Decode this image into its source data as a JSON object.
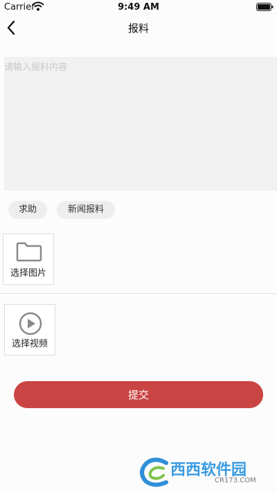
{
  "status_bar": {
    "carrier": "Carrier",
    "time": "9:49 AM"
  },
  "nav": {
    "title": "报料"
  },
  "report": {
    "placeholder": "请输入报料内容"
  },
  "categories": [
    {
      "label": "求助"
    },
    {
      "label": "新闻报料"
    }
  ],
  "media": {
    "image_label": "选择图片",
    "video_label": "选择视频"
  },
  "actions": {
    "submit_label": "提交"
  },
  "colors": {
    "accent": "#c94543",
    "input_bg": "#f1f1f1",
    "chip_bg": "#eeeeee"
  },
  "watermark": {
    "title": "西西软件园",
    "url": "CR173.COM"
  }
}
